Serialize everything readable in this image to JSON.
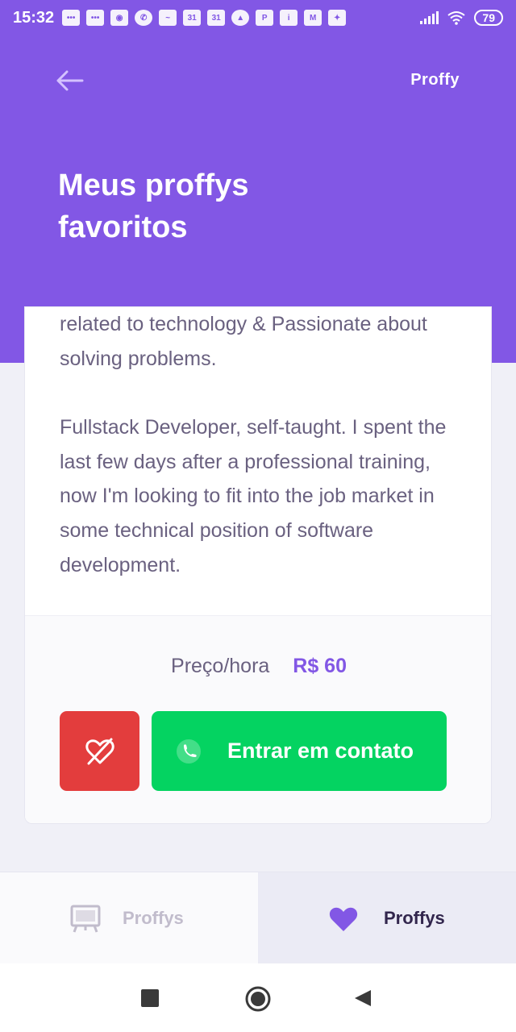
{
  "status_bar": {
    "time": "15:32",
    "calendar_day": "31",
    "battery": "79"
  },
  "header": {
    "brand": "Proffy",
    "title": "Meus proffys favoritos"
  },
  "card": {
    "bio_paragraphs": [
      "related to technology & Passionate about solving problems.",
      "Fullstack Developer, self-taught. I spent the last few days after a professional training, now I'm looking to fit into the job market in some technical position of software development."
    ],
    "price_label": "Preço/hora",
    "price_value": "R$ 60",
    "contact_label": "Entrar em contato"
  },
  "tabs": [
    {
      "label": "Proffys",
      "icon": "easel-icon",
      "active": false
    },
    {
      "label": "Proffys",
      "icon": "heart-icon",
      "active": true
    }
  ],
  "colors": {
    "primary": "#8257e5",
    "danger": "#e33d3d",
    "success": "#04d361"
  }
}
